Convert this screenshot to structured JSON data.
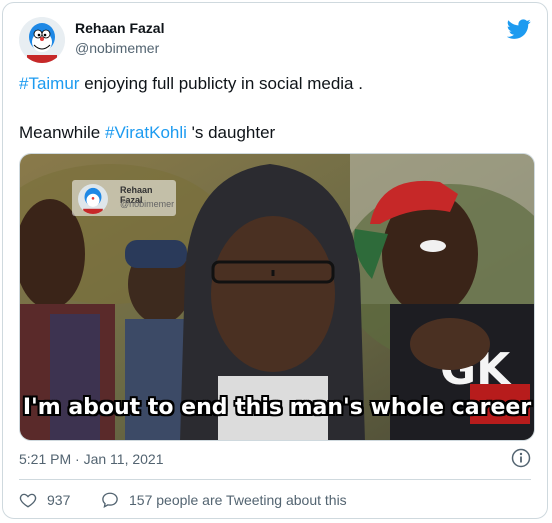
{
  "author": {
    "name": "Rehaan Fazal",
    "handle": "@nobimemer"
  },
  "tweet": {
    "line1_hashtag": "#Taimur",
    "line1_rest": " enjoying full publicty in social media .",
    "line2_prefix": "Meanwhile ",
    "line2_hashtag": "#ViratKohli",
    "line2_rest": " 's daughter"
  },
  "media": {
    "caption": "I'm about to end this man's whole career",
    "watermark_name": "Rehaan Fazal",
    "watermark_handle": "@nobimemer"
  },
  "timestamp": "5:21 PM · Jan 11, 2021",
  "stats": {
    "likes": "937",
    "conversation": "157 people are Tweeting about this"
  },
  "colors": {
    "accent": "#1d9bf0",
    "text": "#0f1419",
    "muted": "#536471",
    "border": "#cfd9de"
  },
  "icons": [
    "avatar",
    "twitter-bird-icon",
    "info-icon",
    "heart-icon",
    "speech-bubble-icon"
  ]
}
